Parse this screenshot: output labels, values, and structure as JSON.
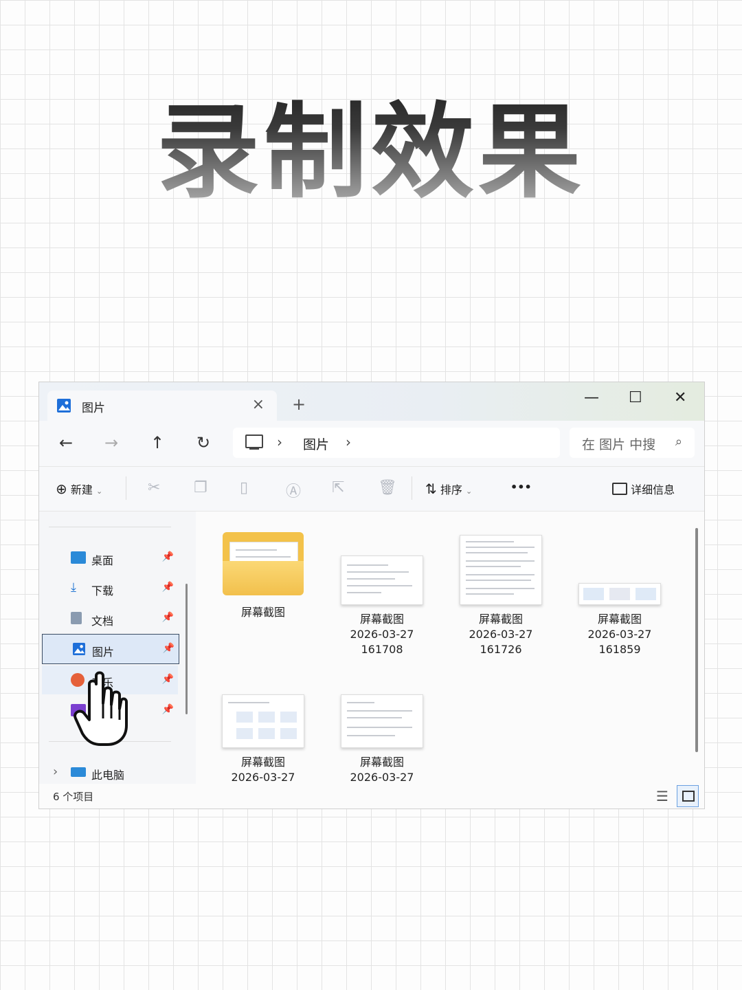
{
  "heading": "录制效果",
  "window": {
    "tab_title": "图片",
    "tab_close": "×",
    "new_tab": "+",
    "minimize": "—",
    "maximize": "☐",
    "close": "✕",
    "nav": {
      "back": "←",
      "forward": "→",
      "up": "↑",
      "refresh": "↻"
    },
    "breadcrumb": {
      "sep1": "›",
      "current": "图片",
      "sep2": "›"
    },
    "search_placeholder": "在 图片 中搜",
    "toolbar": {
      "new_label": "新建",
      "sort_label": "排序",
      "more": "•••",
      "details_label": "详细信息"
    },
    "sidebar": {
      "items": [
        {
          "label": "桌面",
          "icon": "desktop-icon"
        },
        {
          "label": "下载",
          "icon": "download-icon"
        },
        {
          "label": "文档",
          "icon": "document-icon"
        },
        {
          "label": "图片",
          "icon": "pictures-icon"
        },
        {
          "label": "音乐",
          "icon": "music-icon"
        },
        {
          "label": "",
          "icon": "videos-icon"
        }
      ],
      "this_pc": "此电脑",
      "expand": "›"
    },
    "files": [
      {
        "name": "屏幕截图",
        "line2": "",
        "line3": ""
      },
      {
        "name": "屏幕截图",
        "line2": "2026-03-27",
        "line3": "161708"
      },
      {
        "name": "屏幕截图",
        "line2": "2026-03-27",
        "line3": "161726"
      },
      {
        "name": "屏幕截图",
        "line2": "2026-03-27",
        "line3": "161859"
      },
      {
        "name": "屏幕截图",
        "line2": "2026-03-27",
        "line3": ""
      },
      {
        "name": "屏幕截图",
        "line2": "2026-03-27",
        "line3": ""
      }
    ],
    "status": "6 个项目"
  },
  "colors": {
    "accent": "#3a7bd5",
    "folder": "#f3c24a",
    "selected_bg": "#dde8f7"
  }
}
